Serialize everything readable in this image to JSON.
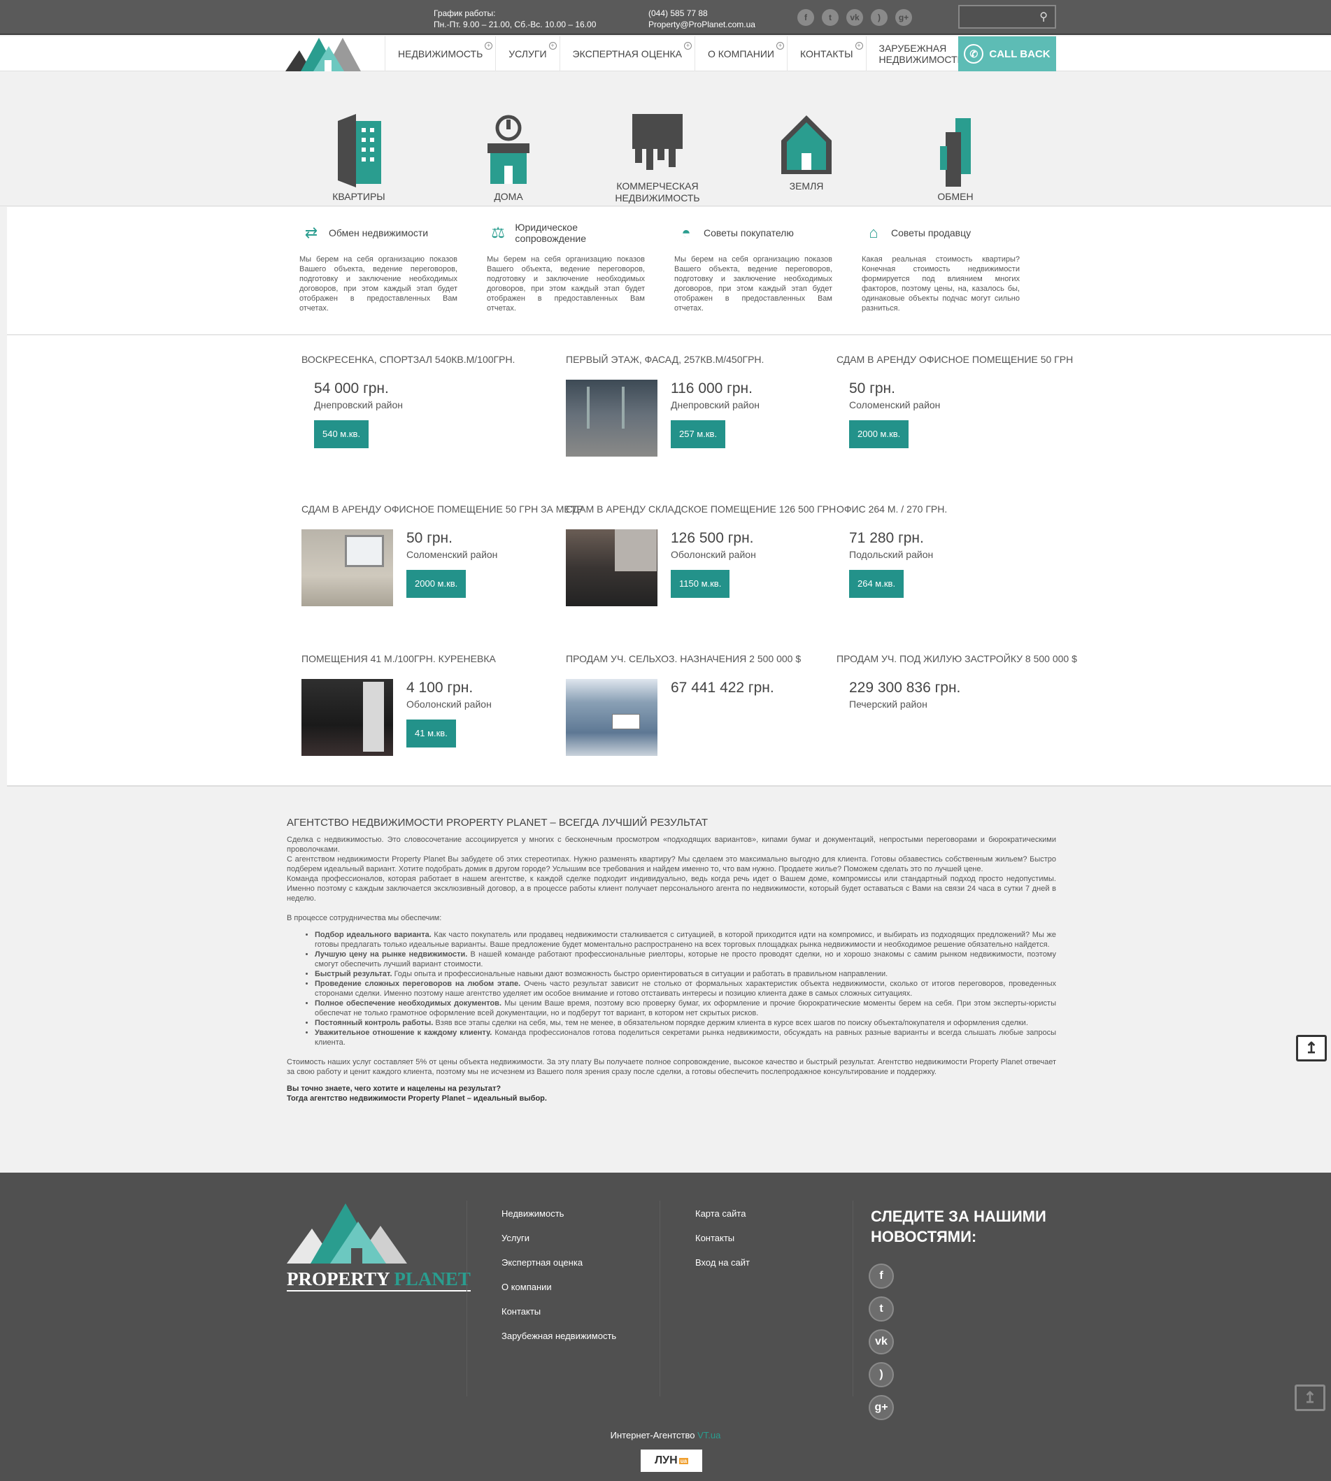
{
  "header": {
    "hours_label": "График работы:",
    "hours_value": "Пн.-Пт. 9.00 – 21.00, Сб.-Вс. 10.00 – 16.00",
    "phone": "(044) 585 77 88",
    "email": "Property@ProPlanet.com.ua",
    "socials": [
      "facebook-icon",
      "twitter-icon",
      "vk-icon",
      "rss-icon",
      "google-plus-icon"
    ],
    "search_placeholder": ""
  },
  "brand": {
    "name_1": "PROPERTY",
    "name_2": "PLANET",
    "accent": "#2a9d8f"
  },
  "nav": {
    "items": [
      "НЕДВИЖИМОСТЬ",
      "УСЛУГИ",
      "ЭКСПЕРТНАЯ ОЦЕНКА",
      "О КОМПАНИИ",
      "КОНТАКТЫ",
      "ЗАРУБЕЖНАЯ НЕДВИЖИМОСТЬ"
    ],
    "callback": "CALL BACK"
  },
  "categories": [
    "КВАРТИРЫ",
    "ДОМА",
    "КОММЕРЧЕСКАЯ НЕДВИЖИМОСТЬ",
    "ЗЕМЛЯ",
    "ОБМЕН"
  ],
  "services": [
    {
      "title": "Обмен недвижимости",
      "text": "Мы берем на себя организацию показов Вашего объекта, ведение переговоров, подготовку и заключение необходимых договоров, при этом каждый этап будет отображен в предоставленных Вам отчетах."
    },
    {
      "title": "Юридическое сопровождение",
      "text": "Мы берем на себя организацию показов Вашего объекта, ведение переговоров, подготовку и заключение необходимых договоров, при этом каждый этап будет отображен в предоставленных Вам отчетах."
    },
    {
      "title": "Советы покупателю",
      "text": "Мы берем на себя организацию показов Вашего объекта, ведение переговоров, подготовку и заключение необходимых договоров, при этом каждый этап будет отображен в предоставленных Вам отчетах."
    },
    {
      "title": "Советы продавцу",
      "text": "Какая реальная стоимость квартиры? Конечная стоимость недвижимости формируется под влиянием многих факторов, поэтому цены, на, казалось бы, одинаковые объекты подчас могут сильно разниться."
    }
  ],
  "listings": [
    {
      "title": "ВОСКРЕСЕНКА, СПОРТЗАЛ 540КВ.М/100ГРН.",
      "price": "54 000 грн.",
      "district": "Днепровский район",
      "area": "540 м.кв."
    },
    {
      "title": "ПЕРВЫЙ ЭТАЖ, ФАСАД, 257КВ.М/450ГРН.",
      "price": "116 000 грн.",
      "district": "Днепровский район",
      "area": "257 м.кв."
    },
    {
      "title": "СДАМ В АРЕНДУ ОФИСНОЕ ПОМЕЩЕНИЕ 50 ГРН",
      "price": "50 грн.",
      "district": "Соломенский район",
      "area": "2000 м.кв."
    },
    {
      "title": "СДАМ В АРЕНДУ ОФИСНОЕ ПОМЕЩЕНИЕ 50 ГРН ЗА МЕТР",
      "price": "50 грн.",
      "district": "Соломенский район",
      "area": "2000 м.кв."
    },
    {
      "title": "СДАМ В АРЕНДУ СКЛАДСКОЕ ПОМЕЩЕНИЕ 126 500 ГРН",
      "price": "126 500 грн.",
      "district": "Оболонский район",
      "area": "1150 м.кв."
    },
    {
      "title": "ОФИС 264 М. / 270 ГРН.",
      "price": "71 280 грн.",
      "district": "Подольский район",
      "area": "264 м.кв."
    },
    {
      "title": "ПОМЕЩЕНИЯ 41 М./100ГРН. КУРЕНЕВКА",
      "price": "4 100 грн.",
      "district": "Оболонский район",
      "area": "41 м.кв."
    },
    {
      "title": "ПРОДАМ УЧ. СЕЛЬХОЗ. НАЗНАЧЕНИЯ 2 500 000 $",
      "price": "67 441 422 грн.",
      "district": "",
      "area": ""
    },
    {
      "title": "ПРОДАМ УЧ. ПОД ЖИЛУЮ ЗАСТРОЙКУ 8 500 000 $",
      "price": "229 300 836 грн.",
      "district": "Печерский район",
      "area": ""
    }
  ],
  "about": {
    "title": "АГЕНТСТВО НЕДВИЖИМОСТИ PROPERTY PLANET – ВСЕГДА ЛУЧШИЙ РЕЗУЛЬТАТ",
    "p1": "Сделка с недвижимостью. Это словосочетание ассоциируется у многих с бесконечным просмотром «подходящих вариантов», кипами бумаг и документаций, непростыми переговорами и бюрократическими проволочками.",
    "p2": "С агентством недвижимости Property Planet Вы забудете об этих стереотипах. Нужно разменять квартиру? Мы сделаем это максимально выгодно для клиента. Готовы обзавестись собственным жильем? Быстро подберем идеальный вариант. Хотите подобрать домик в другом городе? Услышим все требования и найдем именно то, что вам нужно. Продаете жилье? Поможем сделать это по лучшей цене.",
    "p3": "Команда профессионалов, которая работает в нашем агентстве, к каждой сделке подходит индивидуально, ведь когда речь идет о Вашем доме, компромиссы или стандартный подход просто недопустимы. Именно поэтому с каждым заключается эксклюзивный договор, а в процессе работы клиент получает персонального агента по недвижимости, который будет оставаться с Вами на связи 24 часа в сутки 7 дней в неделю.",
    "p4": "В процессе сотрудничества мы обеспечим:",
    "bullets": [
      {
        "b": "Подбор идеального варианта.",
        "t": " Как часто покупатель или продавец недвижимости сталкивается с ситуацией, в которой приходится идти на компромисс, и выбирать из подходящих предложений? Мы же готовы предлагать только идеальные варианты. Ваше предложение будет моментально распространено на всех торговых площадках рынка недвижимости и необходимое решение обязательно найдется."
      },
      {
        "b": "Лучшую цену на рынке недвижимости.",
        "t": " В нашей команде работают профессиональные риелторы, которые не просто проводят сделки, но и хорошо знакомы с самим рынком недвижимости, поэтому смогут обеспечить лучший вариант стоимости."
      },
      {
        "b": "Быстрый результат.",
        "t": " Годы опыта и профессиональные навыки дают возможность быстро ориентироваться в ситуации и работать в правильном направлении."
      },
      {
        "b": "Проведение сложных переговоров на любом этапе.",
        "t": " Очень часто результат зависит не столько от формальных характеристик объекта недвижимости, сколько от итогов переговоров, проведенных сторонами сделки. Именно поэтому наше агентство уделяет им особое внимание и готово отстаивать интересы и позицию клиента даже в самых сложных ситуациях."
      },
      {
        "b": "Полное обеспечение необходимых документов.",
        "t": " Мы ценим Ваше время, поэтому всю проверку бумаг, их оформление и прочие бюрократические моменты берем на себя. При этом эксперты-юристы обеспечат не только грамотное оформление всей документации, но и подберут тот вариант, в котором нет скрытых рисков."
      },
      {
        "b": "Постоянный контроль работы.",
        "t": " Взяв все этапы сделки на себя, мы, тем не менее, в обязательном порядке держим клиента в курсе всех шагов по поиску объекта/покупателя и оформления сделки."
      },
      {
        "b": "Уважительное отношение к каждому клиенту.",
        "t": " Команда профессионалов готова поделиться секретами рынка недвижимости, обсуждать на равных разные варианты и всегда слышать любые запросы клиента."
      }
    ],
    "p5": "Стоимость наших услуг составляет 5% от цены объекта недвижимости. За эту плату Вы получаете полное сопровождение, высокое качество и быстрый результат. Агентство недвижимости Property Planet отвечает за свою работу и ценит каждого клиента, поэтому мы не исчезнем из Вашего поля зрения сразу после сделки, а готовы обеспечить послепродажное консультирование и поддержку.",
    "final1": "Вы точно знаете, чего хотите и нацелены на результат?",
    "final2": "Тогда агентство недвижимости Property Planet – идеальный выбор."
  },
  "footer": {
    "col1": [
      "Недвижимость",
      "Услуги",
      "Экспертная оценка",
      "О компании",
      "Контакты",
      "Зарубежная недвижимость"
    ],
    "col2": [
      "Карта сайта",
      "Контакты",
      "Вход на сайт"
    ],
    "follow_1": "СЛЕДИТЕ ЗА НАШИМИ",
    "follow_2": "НОВОСТЯМИ:",
    "agency_text": "Интернет-Агентство ",
    "agency_link": "VT.ua",
    "lun": "ЛУН",
    "lun_badge": "ua"
  }
}
